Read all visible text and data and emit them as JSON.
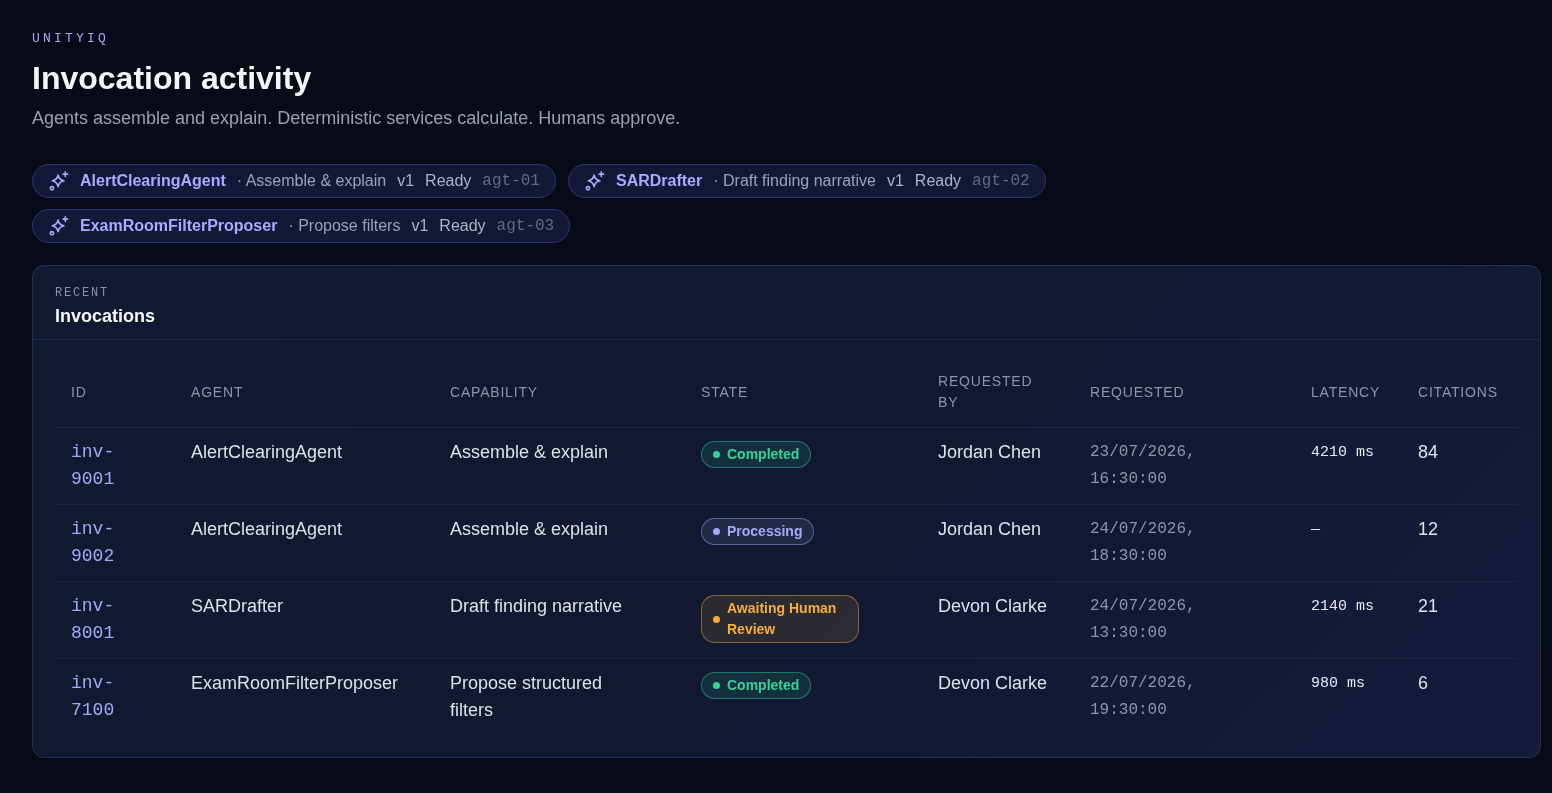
{
  "brand": "UNITYIQ",
  "title": "Invocation activity",
  "subtitle": "Agents assemble and explain. Deterministic services calculate. Humans approve.",
  "agents": [
    {
      "name": "AlertClearingAgent",
      "capability": "· Assemble & explain",
      "version": "v1",
      "status": "Ready",
      "id": "agt-01"
    },
    {
      "name": "SARDrafter",
      "capability": "· Draft finding narrative",
      "version": "v1",
      "status": "Ready",
      "id": "agt-02"
    },
    {
      "name": "ExamRoomFilterProposer",
      "capability": "· Propose filters",
      "version": "v1",
      "status": "Ready",
      "id": "agt-03"
    }
  ],
  "invocations": {
    "eyebrow": "RECENT",
    "title": "Invocations",
    "columns": [
      "ID",
      "AGENT",
      "CAPABILITY",
      "STATE",
      "REQUESTED BY",
      "REQUESTED",
      "LATENCY",
      "CITATIONS"
    ],
    "rows": [
      {
        "id": "inv-9001",
        "agent": "AlertClearingAgent",
        "capability": "Assemble & explain",
        "state": {
          "label": "Completed",
          "color": "#34d399"
        },
        "requested_by": "Jordan Chen",
        "requested": "23/07/2026, 16:30:00",
        "latency": "4210 ms",
        "citations": "84"
      },
      {
        "id": "inv-9002",
        "agent": "AlertClearingAgent",
        "capability": "Assemble & explain",
        "state": {
          "label": "Processing",
          "color": "#a5aaf8"
        },
        "requested_by": "Jordan Chen",
        "requested": "24/07/2026, 18:30:00",
        "latency": "—",
        "citations": "12"
      },
      {
        "id": "inv-8001",
        "agent": "SARDrafter",
        "capability": "Draft finding narrative",
        "state": {
          "label": "Awaiting Human Review",
          "color": "#f6ad3c"
        },
        "requested_by": "Devon Clarke",
        "requested": "24/07/2026, 13:30:00",
        "latency": "2140 ms",
        "citations": "21"
      },
      {
        "id": "inv-7100",
        "agent": "ExamRoomFilterProposer",
        "capability": "Propose structured filters",
        "state": {
          "label": "Completed",
          "color": "#34d399"
        },
        "requested_by": "Devon Clarke",
        "requested": "22/07/2026, 19:30:00",
        "latency": "980 ms",
        "citations": "6"
      }
    ]
  }
}
